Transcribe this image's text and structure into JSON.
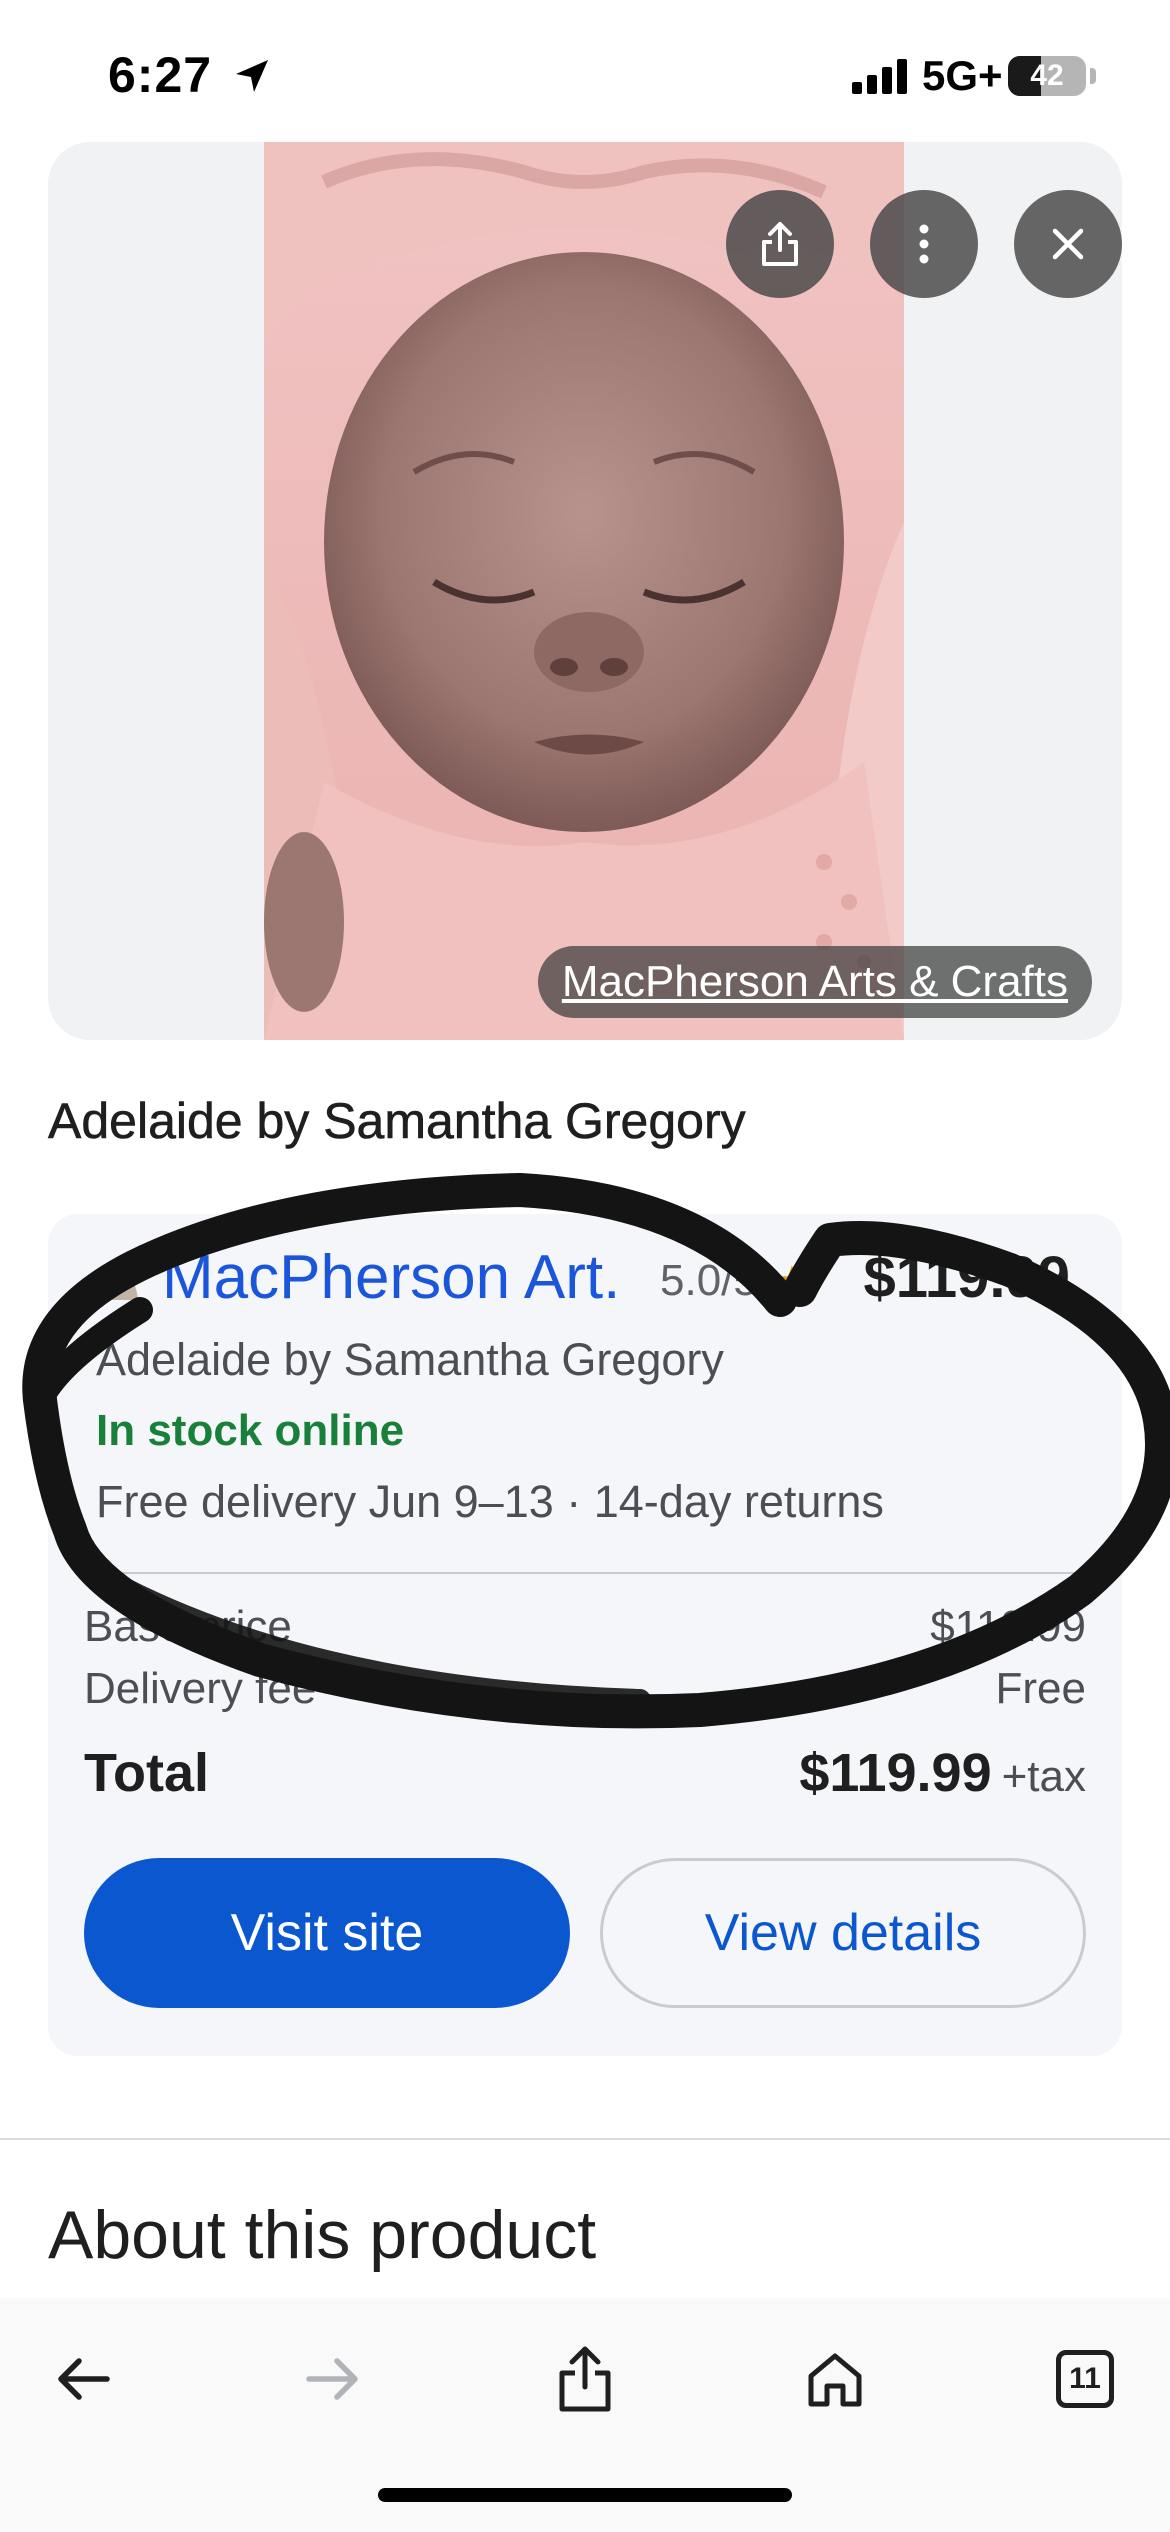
{
  "status_bar": {
    "time": "6:27",
    "network": "5G+",
    "battery": "42",
    "battery_level": 0.42
  },
  "image_card": {
    "image_alt": "Reborn baby doll in pink outfit",
    "share_icon": "share-icon",
    "more_icon": "more-vert-icon",
    "close_icon": "close-icon",
    "source_label": "MacPherson Arts & Crafts"
  },
  "product": {
    "title": "Adelaide by Samantha Gregory"
  },
  "offer": {
    "merchant_name": "MacPherson Art.",
    "rating": "5.0/5",
    "price": "$119.99",
    "product_name": "Adelaide by Samantha Gregory",
    "stock": "In stock online",
    "delivery": "Free delivery Jun 9–13 · 14-day returns",
    "base_price_label": "Base price",
    "base_price_value": "$119.99",
    "delivery_fee_label": "Delivery fee",
    "delivery_fee_value": "Free",
    "total_label": "Total",
    "total_value": "$119.99",
    "tax_suffix": "+tax",
    "visit_button": "Visit site",
    "details_button": "View details"
  },
  "about": {
    "heading": "About this product"
  },
  "toolbar": {
    "back_icon": "back-arrow-icon",
    "forward_icon": "forward-arrow-icon",
    "share_icon": "share-icon",
    "home_icon": "home-icon",
    "tabs_count": "11"
  },
  "colors": {
    "link_blue": "#1a56db",
    "button_blue": "#0b57d0",
    "stock_green": "#188038",
    "card_bg": "#f4f6f9"
  }
}
